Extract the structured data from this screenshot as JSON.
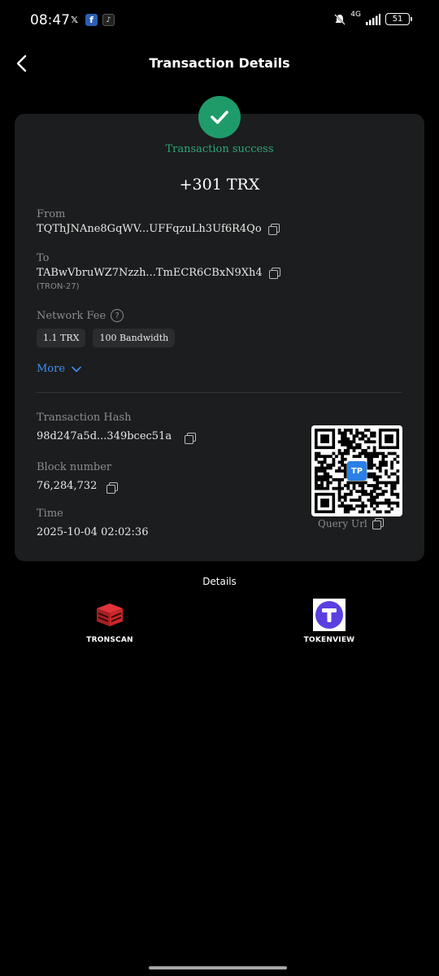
{
  "status_bar": {
    "time": "08:47",
    "network": "4G",
    "battery": "51",
    "notification_icons": [
      "x-icon",
      "facebook-icon",
      "tiktok-icon"
    ]
  },
  "header": {
    "title": "Transaction Details"
  },
  "transaction": {
    "status": "Transaction success",
    "amount": "+301 TRX",
    "from_label": "From",
    "from_value": "TQThJNAne8GqWV...UFFqzuLh3Uf6R4Qo",
    "to_label": "To",
    "to_value": "TABwVbruWZ7Nzzh...TmECR6CBxN9Xh4",
    "to_note": "(TRON-27)",
    "fee_label": "Network Fee",
    "fee_help": "?",
    "fee_chips": [
      "1.1 TRX",
      "100 Bandwidth"
    ],
    "more_label": "More",
    "hash_label": "Transaction Hash",
    "hash_value": "98d247a5d...349bcec51a",
    "block_label": "Block number",
    "block_value": "76,284,732",
    "time_label": "Time",
    "time_value": "2025-10-04 02:02:36",
    "qr_logo": "TP",
    "query_url_label": "Query Url"
  },
  "details": {
    "title": "Details",
    "explorers": [
      {
        "name": "TRONSCAN"
      },
      {
        "name": "TOKENVIEW"
      }
    ]
  },
  "colors": {
    "success": "#1f9b6a",
    "link": "#3f8ef0",
    "card": "#1b1d1e",
    "tronscan": "#c8262b",
    "tokenview": "#5b3fe0"
  }
}
